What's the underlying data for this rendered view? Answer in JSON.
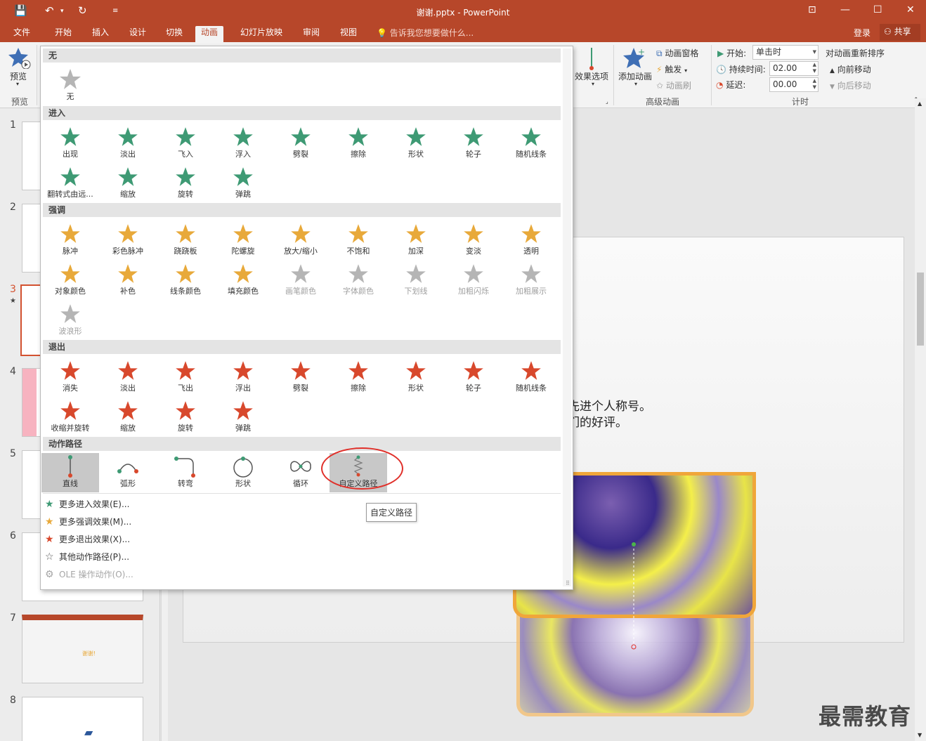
{
  "window": {
    "title": "谢谢.pptx - PowerPoint",
    "tell_me": "告诉我您想要做什么...",
    "login": "登录",
    "share": "共享"
  },
  "tabs": [
    "文件",
    "开始",
    "插入",
    "设计",
    "切换",
    "动画",
    "幻灯片放映",
    "审阅",
    "视图"
  ],
  "ribbon": {
    "preview": "预览",
    "preview_group": "预览",
    "effect_options": "效果选项",
    "add_animation": "添加动画",
    "animation_pane": "动画窗格",
    "trigger": "触发",
    "animation_painter": "动画刷",
    "advanced_group": "高级动画",
    "start_label": "开始:",
    "start_value": "单击时",
    "duration_label": "持续时间:",
    "duration_value": "02.00",
    "delay_label": "延迟:",
    "delay_value": "00.00",
    "timing_group": "计时",
    "reorder_title": "对动画重新排序",
    "move_earlier": "向前移动",
    "move_later": "向后移动"
  },
  "thumbnails": [
    "1",
    "2",
    "3",
    "4",
    "5",
    "6",
    "7",
    "8"
  ],
  "slide": {
    "line1": "先进个人称号。",
    "line2": "们的好评。",
    "thumb7_text": "谢谢!"
  },
  "gallery": {
    "none_header": "无",
    "none_item": "无",
    "entrance_header": "进入",
    "entrance": [
      "出现",
      "淡出",
      "飞入",
      "浮入",
      "劈裂",
      "擦除",
      "形状",
      "轮子",
      "随机线条",
      "翻转式由远...",
      "缩放",
      "旋转",
      "弹跳"
    ],
    "emphasis_header": "强调",
    "emphasis": [
      "脉冲",
      "彩色脉冲",
      "跷跷板",
      "陀螺旋",
      "放大/缩小",
      "不饱和",
      "加深",
      "变淡",
      "透明",
      "对象颜色",
      "补色",
      "线条颜色",
      "填充颜色",
      "画笔颜色",
      "字体颜色",
      "下划线",
      "加粗闪烁",
      "加粗展示",
      "波浪形"
    ],
    "exit_header": "退出",
    "exit": [
      "消失",
      "淡出",
      "飞出",
      "浮出",
      "劈裂",
      "擦除",
      "形状",
      "轮子",
      "随机线条",
      "收缩并旋转",
      "缩放",
      "旋转",
      "弹跳"
    ],
    "path_header": "动作路径",
    "paths": [
      "直线",
      "弧形",
      "转弯",
      "形状",
      "循环",
      "自定义路径"
    ],
    "more": [
      "更多进入效果(E)...",
      "更多强调效果(M)...",
      "更多退出效果(X)...",
      "其他动作路径(P)...",
      "OLE 操作动作(O)..."
    ],
    "tooltip": "自定义路径"
  },
  "watermark": "最需教育",
  "colors": {
    "accent": "#b7472a",
    "entrance": "#3e9a74",
    "emphasis": "#e8a93a",
    "exit": "#d8482c",
    "disabled": "#b5b5b5"
  }
}
